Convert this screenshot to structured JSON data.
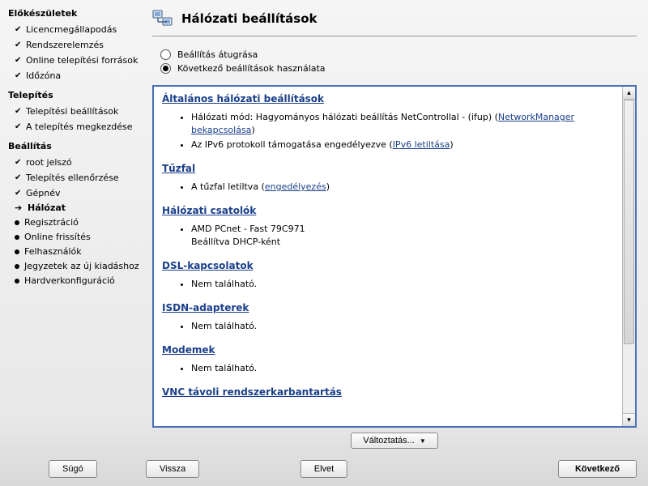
{
  "sidebar": {
    "sections": [
      {
        "title": "Előkészületek",
        "items": [
          {
            "label": "Licencmegállapodás",
            "state": "done"
          },
          {
            "label": "Rendszerelemzés",
            "state": "done"
          },
          {
            "label": "Online telepítési források",
            "state": "done"
          },
          {
            "label": "Időzóna",
            "state": "done"
          }
        ]
      },
      {
        "title": "Telepítés",
        "items": [
          {
            "label": "Telepítési beállítások",
            "state": "done"
          },
          {
            "label": "A telepítés megkezdése",
            "state": "done"
          }
        ]
      },
      {
        "title": "Beállítás",
        "items": [
          {
            "label": "root jelszó",
            "state": "done"
          },
          {
            "label": "Telepítés ellenőrzése",
            "state": "done"
          },
          {
            "label": "Gépnév",
            "state": "done"
          },
          {
            "label": "Hálózat",
            "state": "current"
          },
          {
            "label": "Regisztráció",
            "state": "todo"
          },
          {
            "label": "Online frissítés",
            "state": "todo"
          },
          {
            "label": "Felhasználók",
            "state": "todo"
          },
          {
            "label": "Jegyzetek az új kiadáshoz",
            "state": "todo"
          },
          {
            "label": "Hardverkonfiguráció",
            "state": "todo"
          }
        ]
      }
    ]
  },
  "main": {
    "title": "Hálózati beállítások",
    "radios": {
      "skip": "Beállítás átugrása",
      "use": "Következő beállítások használata",
      "selected": "use"
    },
    "sections": {
      "general": {
        "heading": "Általános hálózati beállítások",
        "mode_prefix": "Hálózati mód: Hagyományos hálózati beállítás NetControllal - (ifup) (",
        "mode_link": "NetworkManager bekapcsolása",
        "mode_suffix": ")",
        "ipv6_prefix": "Az IPv6 protokoll támogatása engedélyezve (",
        "ipv6_link": "IPv6 letiltása",
        "ipv6_suffix": ")"
      },
      "firewall": {
        "heading": "Tűzfal",
        "text_prefix": "A tűzfal letiltva (",
        "text_link": "engedélyezés",
        "text_suffix": ")"
      },
      "interfaces": {
        "heading": "Hálózati csatolók",
        "line1": "AMD PCnet - Fast 79C971",
        "line2": "Beállítva DHCP-ként"
      },
      "dsl": {
        "heading": "DSL-kapcsolatok",
        "text": "Nem található."
      },
      "isdn": {
        "heading": "ISDN-adapterek",
        "text": "Nem található."
      },
      "modems": {
        "heading": "Modemek",
        "text": "Nem található."
      },
      "vnc": {
        "heading": "VNC távoli rendszerkarbantartás"
      }
    },
    "change_button": "Változtatás..."
  },
  "footer": {
    "help": "Súgó",
    "back": "Vissza",
    "abort": "Elvet",
    "next": "Következő"
  }
}
